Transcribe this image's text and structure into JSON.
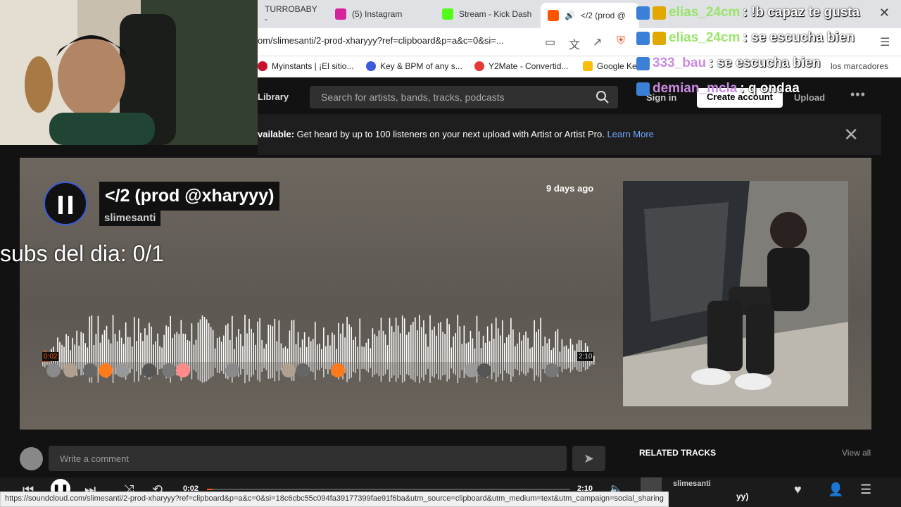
{
  "browser": {
    "tabs": [
      {
        "label": "TURROBABY -",
        "color": "#1f1f1f"
      },
      {
        "label": "(5) Instagram",
        "color": "#d6249f"
      },
      {
        "label": "Stream - Kick Dash",
        "color": "#53fc18"
      },
      {
        "label": "</2 (prod @",
        "color": "#ff5500"
      }
    ],
    "url": "om/slimesanti/2-prod-xharyyy?ref=clipboard&p=a&c=0&si=...",
    "bookmarks": [
      {
        "label": "Myinstants | ¡El sitio...",
        "color": "#c8102e"
      },
      {
        "label": "Key & BPM of any s...",
        "color": "#3b5bdb"
      },
      {
        "label": "Y2Mate - Convertid...",
        "color": "#e53935"
      },
      {
        "label": "Google Ke",
        "color": "#fbbc04"
      }
    ],
    "bookmarks_extra": "los marcadores"
  },
  "soundcloud": {
    "library": "Library",
    "search_placeholder": "Search for artists, bands, tracks, podcasts",
    "sign_in": "Sign in",
    "create_account": "Create account",
    "upload": "Upload",
    "more": "•••",
    "banner": {
      "bold": "vailable:",
      "text": " Get heard by up to 100 listeners on your next upload with Artist or Artist Pro. ",
      "link": "Learn More"
    },
    "track": {
      "title": "</2 (prod @xharyyy)",
      "artist": "slimesanti",
      "posted": "9 days ago",
      "time_start": "0:02",
      "time_end": "2:10"
    },
    "comment_placeholder": "Write a comment",
    "related_tracks": "RELATED TRACKS",
    "view_all": "View all"
  },
  "player": {
    "time_current": "0:02",
    "time_total": "2:10",
    "progress": 0.015,
    "artist": "slimesanti",
    "title_tail": "yy)"
  },
  "overlay": {
    "subs": "subs del dia: 0/1",
    "chat": [
      {
        "user": "elias_24cm",
        "msg": ": !b capaz te gusta",
        "color": "#9be36b"
      },
      {
        "user": "elias_24cm",
        "msg": ": se escucha bien",
        "color": "#9be36b"
      },
      {
        "user": "333_bau",
        "msg": ": se escucha bien",
        "color": "#c98be0"
      },
      {
        "user": "demian_mcla",
        "msg": ": q ondaa",
        "color": "#c98be0"
      }
    ]
  },
  "status_url": "https://soundcloud.com/slimesanti/2-prod-xharyyy?ref=clipboard&p=a&c=0&si=18c6cbc55c094fa39177399fae91f6ba&utm_source=clipboard&utm_medium=text&utm_campaign=social_sharing",
  "colors": {
    "accent": "#ff5500",
    "background": "#121212"
  }
}
